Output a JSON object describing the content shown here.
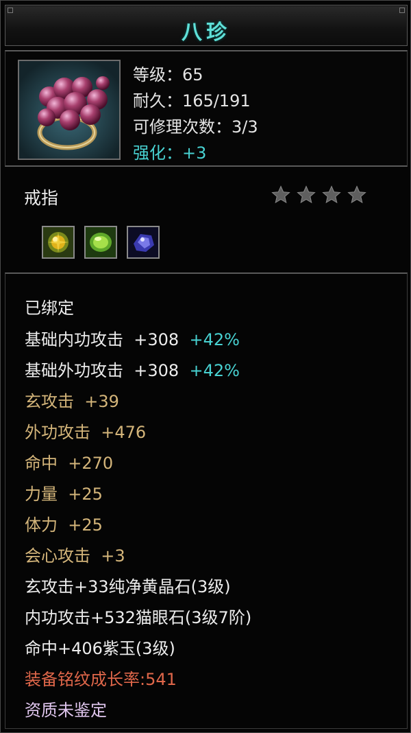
{
  "title": "八珍",
  "item": {
    "icon": "grape-ring-icon",
    "stats": [
      {
        "label": "等级：65"
      },
      {
        "label": "耐久：165/191"
      },
      {
        "label": "可修理次数：3/3"
      },
      {
        "label": "强化：+3"
      }
    ],
    "type": "戒指",
    "star_count": 4,
    "gems": [
      "yellow-crystal-gem-icon",
      "green-cats-eye-gem-icon",
      "purple-jade-gem-icon"
    ]
  },
  "properties": {
    "bound": "已绑定",
    "base_inner": {
      "label": "基础内功攻击",
      "value": "+308",
      "pct": "+42%"
    },
    "base_outer": {
      "label": "基础外功攻击",
      "value": "+308",
      "pct": "+42%"
    },
    "attrs": [
      {
        "label": "玄攻击",
        "value": "+39"
      },
      {
        "label": "外功攻击",
        "value": "+476"
      },
      {
        "label": "命中",
        "value": "+270"
      },
      {
        "label": "力量",
        "value": "+25"
      },
      {
        "label": "体力",
        "value": "+25"
      },
      {
        "label": "会心攻击",
        "value": "+3"
      }
    ],
    "gem_lines": [
      "玄攻击+33纯净黄晶石(3级)",
      "内功攻击+532猫眼石(3级7阶)",
      "命中+406紫玉(3级)"
    ],
    "growth": "装备铭纹成长率:541",
    "aptitude": "资质未鉴定"
  },
  "colors": {
    "title": "#5fe0d8",
    "cyan": "#48d2d2",
    "gold": "#d4b57a",
    "red": "#e0674a"
  }
}
